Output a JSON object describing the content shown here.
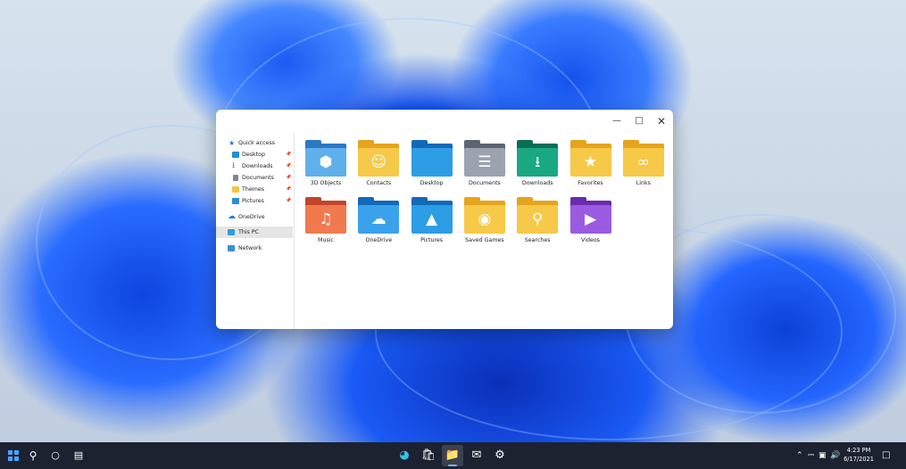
{
  "window": {
    "minimize_icon": "minimize-icon",
    "maximize_icon": "maximize-icon",
    "close_icon": "close-icon"
  },
  "nav": {
    "quick_access": "Quick access",
    "pinned": [
      {
        "label": "Desktop",
        "icon": "desktop-icon",
        "color": "#1e90d6"
      },
      {
        "label": "Downloads",
        "icon": "download-icon",
        "color": "#1b9e77"
      },
      {
        "label": "Documents",
        "icon": "document-icon",
        "color": "#7d8796"
      },
      {
        "label": "Themes",
        "icon": "folder-icon",
        "color": "#f5c542"
      },
      {
        "label": "Pictures",
        "icon": "picture-icon",
        "color": "#2a8fd8"
      }
    ],
    "onedrive": "OneDrive",
    "this_pc": "This PC",
    "network": "Network"
  },
  "folders": [
    {
      "label": "3D Objects",
      "icon": "3d-cube-icon",
      "glyph": "⬢",
      "back": "#2b78c4",
      "front": "#5fb0ea"
    },
    {
      "label": "Contacts",
      "icon": "contact-icon",
      "glyph": "☺",
      "back": "#e5a41c",
      "front": "#f7c948"
    },
    {
      "label": "Desktop",
      "icon": "desktop-icon",
      "glyph": "",
      "back": "#1169b8",
      "front": "#2d9de6"
    },
    {
      "label": "Documents",
      "icon": "document-icon",
      "glyph": "☰",
      "back": "#5b6472",
      "front": "#9aa3af"
    },
    {
      "label": "Downloads",
      "icon": "download-icon",
      "glyph": "⭳",
      "back": "#0c6d55",
      "front": "#1aa882"
    },
    {
      "label": "Favorites",
      "icon": "star-icon",
      "glyph": "★",
      "back": "#e5a41c",
      "front": "#f7c948"
    },
    {
      "label": "Links",
      "icon": "link-icon",
      "glyph": "∞",
      "back": "#e5a41c",
      "front": "#f7c948"
    },
    {
      "label": "Music",
      "icon": "music-note-icon",
      "glyph": "♫",
      "back": "#c2452a",
      "front": "#f07a4e"
    },
    {
      "label": "OneDrive",
      "icon": "cloud-icon",
      "glyph": "☁",
      "back": "#1169b8",
      "front": "#3aa2ea"
    },
    {
      "label": "Pictures",
      "icon": "mountain-icon",
      "glyph": "▲",
      "back": "#1169b8",
      "front": "#2d9de6"
    },
    {
      "label": "Saved Games",
      "icon": "gamepad-icon",
      "glyph": "◉",
      "back": "#e5a41c",
      "front": "#f7c948"
    },
    {
      "label": "Searches",
      "icon": "magnifier-icon",
      "glyph": "⚲",
      "back": "#e5a41c",
      "front": "#f7c948"
    },
    {
      "label": "Videos",
      "icon": "play-icon",
      "glyph": "▶",
      "back": "#6a2bb0",
      "front": "#9b5be0"
    }
  ],
  "taskbar": {
    "start_icon": "windows-logo-icon",
    "search_icon": "search-icon",
    "cortana_icon": "circle-icon",
    "taskview_icon": "task-view-icon",
    "apps": [
      "edge-icon",
      "store-icon",
      "file-explorer-icon",
      "mail-icon",
      "settings-icon"
    ],
    "tray": [
      "chevron-up-icon",
      "usb-icon",
      "network-icon",
      "volume-icon"
    ],
    "time": "4:23 PM",
    "date": "6/17/2021",
    "notifications_icon": "notification-icon"
  }
}
